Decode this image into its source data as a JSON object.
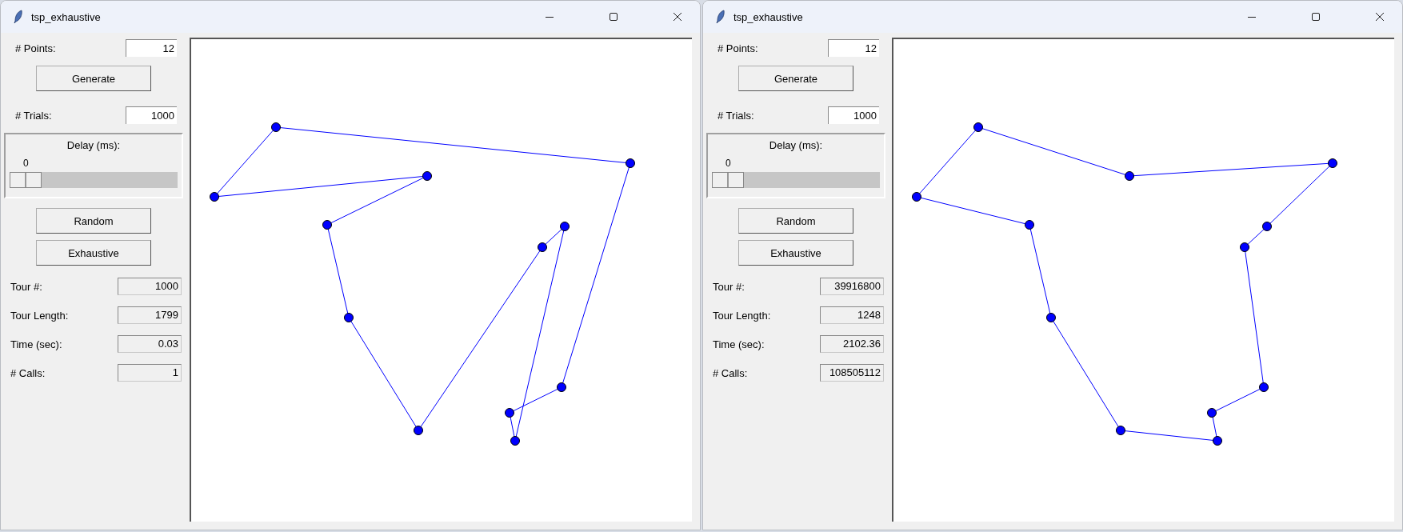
{
  "windows": [
    {
      "title": "tsp_exhaustive",
      "points": {
        "label": "# Points:",
        "value": "12"
      },
      "generate_button": "Generate",
      "trials": {
        "label": "# Trials:",
        "value": "1000"
      },
      "delay": {
        "label": "Delay (ms):",
        "reading": "0",
        "level": 0
      },
      "buttons": [
        "Random",
        "Exhaustive"
      ],
      "stats": [
        {
          "label": "Tour #:",
          "value": "1000"
        },
        {
          "label": "Tour Length:",
          "value": "1799"
        },
        {
          "label": "Time (sec):",
          "value": "0.03"
        },
        {
          "label": "# Calls:",
          "value": "1"
        }
      ],
      "canvas": {
        "kind": "random_tour"
      }
    },
    {
      "title": "tsp_exhaustive",
      "points": {
        "label": "# Points:",
        "value": "12"
      },
      "generate_button": "Generate",
      "trials": {
        "label": "# Trials:",
        "value": "1000"
      },
      "delay": {
        "label": "Delay (ms):",
        "reading": "0",
        "level": 0
      },
      "buttons": [
        "Random",
        "Exhaustive"
      ],
      "stats": [
        {
          "label": "Tour #:",
          "value": "39916800"
        },
        {
          "label": "Tour Length:",
          "value": "1248"
        },
        {
          "label": "Time (sec):",
          "value": "2102.36"
        },
        {
          "label": "# Calls:",
          "value": "108505112"
        }
      ],
      "canvas": {
        "kind": "optimal_tour"
      }
    }
  ]
}
